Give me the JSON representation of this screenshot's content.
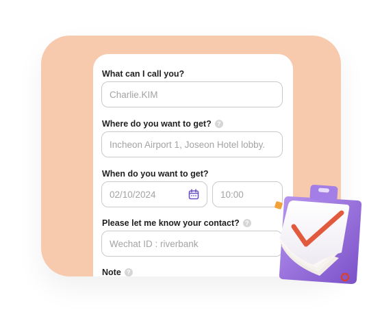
{
  "form": {
    "name": {
      "label": "What can I call you?",
      "value": "Charlie.KIM"
    },
    "destination": {
      "label": "Where do you want to get?",
      "value": "Incheon Airport 1, Joseon Hotel lobby."
    },
    "when": {
      "label": "When do you want to get?",
      "date": "02/10/2024",
      "time": "10:00"
    },
    "contact": {
      "label": "Please let me know your contact?",
      "value": "Wechat ID : riverbank"
    },
    "note": {
      "label": "Note"
    },
    "help_glyph": "?"
  },
  "icons": [
    "calendar-icon",
    "help-icon",
    "clipboard-illustration",
    "checkmark-icon"
  ],
  "colors": {
    "peach_background": "#f7c9ad",
    "card": "#ffffff",
    "field_border": "#c9c9c9",
    "placeholder_text": "#a3a3a3",
    "calendar_icon": "#6b4fc8",
    "clipboard_purple": "#8a63d2",
    "check_red": "#e25a3d"
  }
}
